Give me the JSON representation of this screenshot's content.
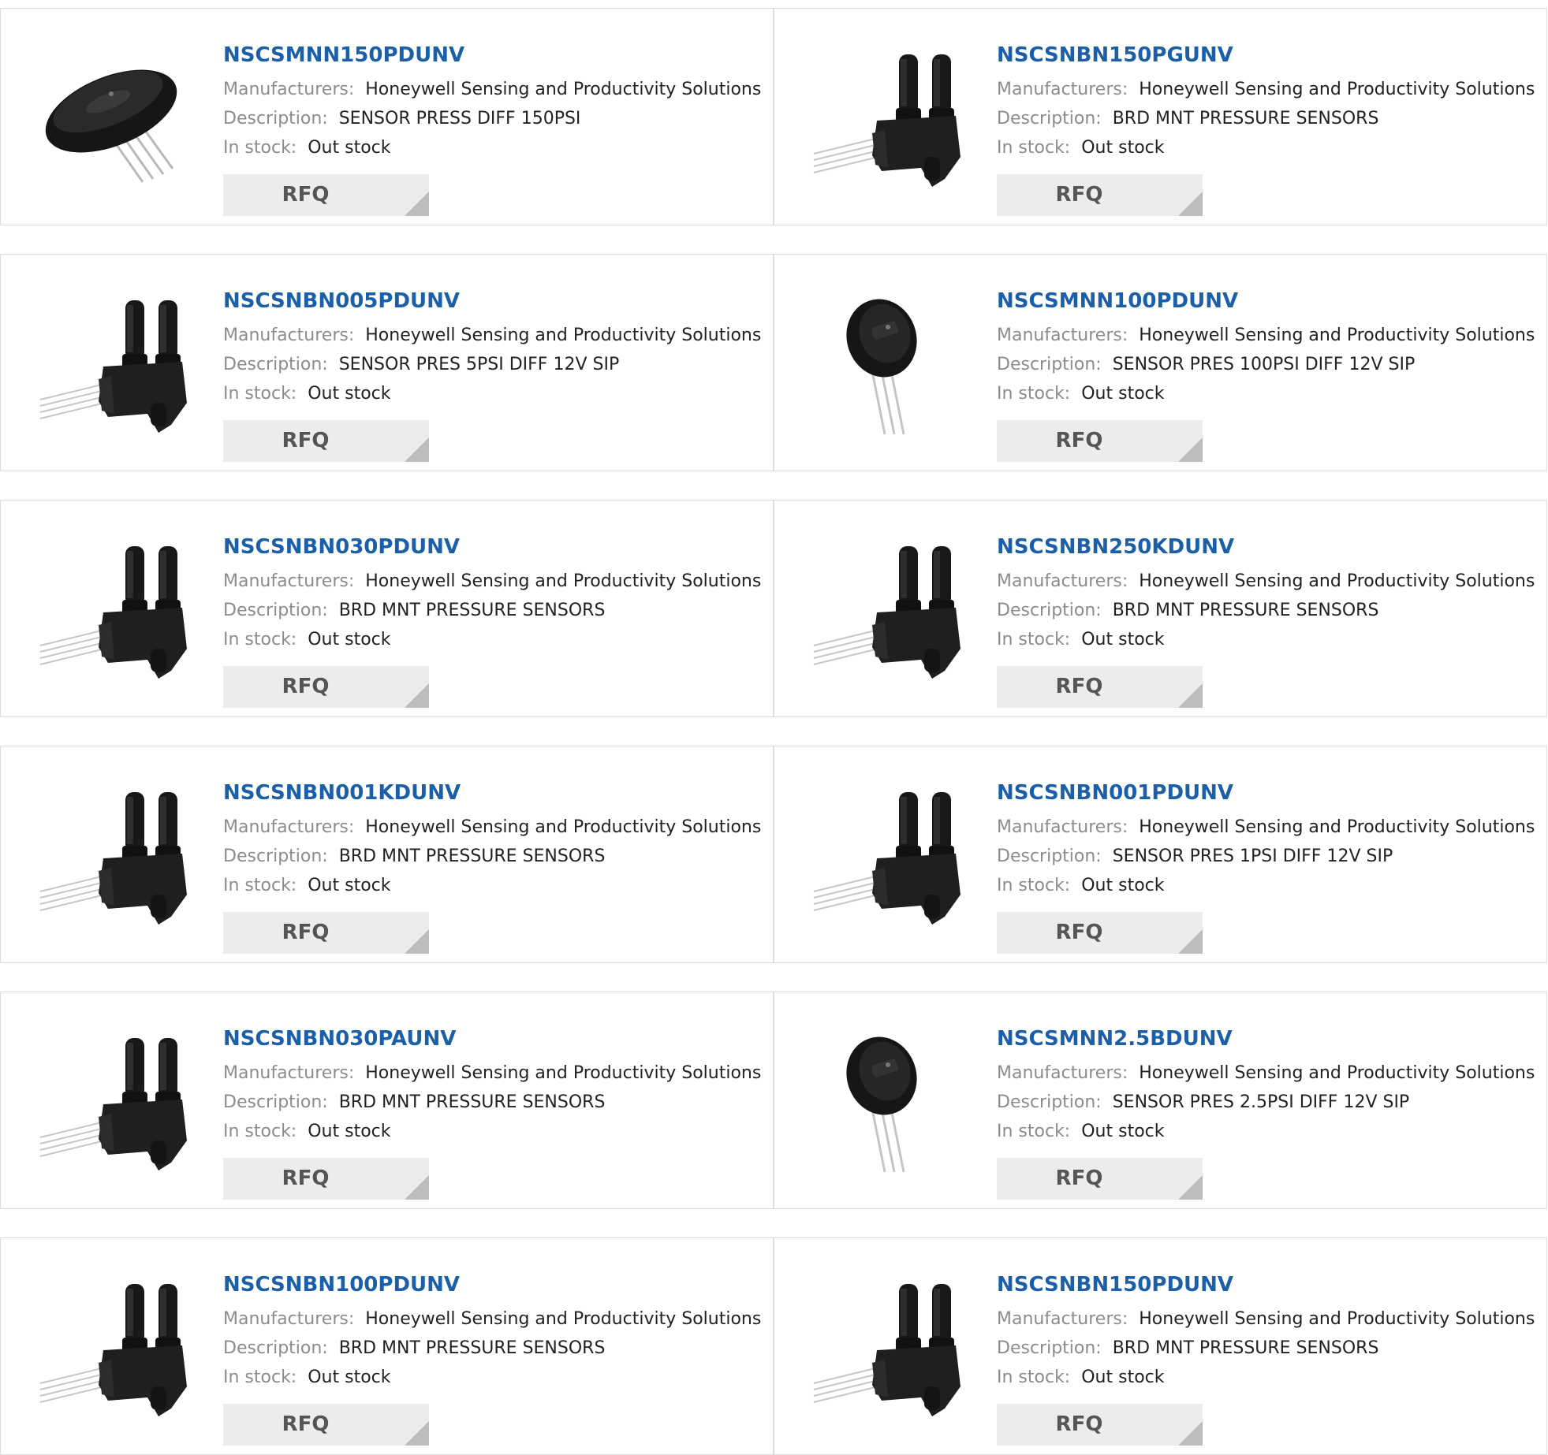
{
  "labels": {
    "manufacturers": "Manufacturers:",
    "description": "Description:",
    "in_stock": "In stock:",
    "rfq": "RFQ"
  },
  "products": [
    {
      "part": "NSCSMNN150PDUNV",
      "manufacturer": "Honeywell Sensing and Productivity Solutions",
      "description": "SENSOR PRESS DIFF 150PSI",
      "stock": "Out stock",
      "image": "round-sensor-horizontal"
    },
    {
      "part": "NSCSNBN150PGUNV",
      "manufacturer": "Honeywell Sensing and Productivity Solutions",
      "description": "BRD MNT PRESSURE SENSORS",
      "stock": "Out stock",
      "image": "dual-port-sensor"
    },
    {
      "part": "NSCSNBN005PDUNV",
      "manufacturer": "Honeywell Sensing and Productivity Solutions",
      "description": "SENSOR PRES 5PSI DIFF 12V SIP",
      "stock": "Out stock",
      "image": "dual-port-sensor"
    },
    {
      "part": "NSCSMNN100PDUNV",
      "manufacturer": "Honeywell Sensing and Productivity Solutions",
      "description": "SENSOR PRES 100PSI DIFF 12V SIP",
      "stock": "Out stock",
      "image": "round-sensor-vertical"
    },
    {
      "part": "NSCSNBN030PDUNV",
      "manufacturer": "Honeywell Sensing and Productivity Solutions",
      "description": "BRD MNT PRESSURE SENSORS",
      "stock": "Out stock",
      "image": "dual-port-sensor"
    },
    {
      "part": "NSCSNBN250KDUNV",
      "manufacturer": "Honeywell Sensing and Productivity Solutions",
      "description": "BRD MNT PRESSURE SENSORS",
      "stock": "Out stock",
      "image": "dual-port-sensor"
    },
    {
      "part": "NSCSNBN001KDUNV",
      "manufacturer": "Honeywell Sensing and Productivity Solutions",
      "description": "BRD MNT PRESSURE SENSORS",
      "stock": "Out stock",
      "image": "dual-port-sensor"
    },
    {
      "part": "NSCSNBN001PDUNV",
      "manufacturer": "Honeywell Sensing and Productivity Solutions",
      "description": "SENSOR PRES 1PSI DIFF 12V SIP",
      "stock": "Out stock",
      "image": "dual-port-sensor"
    },
    {
      "part": "NSCSNBN030PAUNV",
      "manufacturer": "Honeywell Sensing and Productivity Solutions",
      "description": "BRD MNT PRESSURE SENSORS",
      "stock": "Out stock",
      "image": "dual-port-sensor"
    },
    {
      "part": "NSCSMNN2.5BDUNV",
      "manufacturer": "Honeywell Sensing and Productivity Solutions",
      "description": "SENSOR PRES 2.5PSI DIFF 12V SIP",
      "stock": "Out stock",
      "image": "round-sensor-vertical"
    },
    {
      "part": "NSCSNBN100PDUNV",
      "manufacturer": "Honeywell Sensing and Productivity Solutions",
      "description": "BRD MNT PRESSURE SENSORS",
      "stock": "Out stock",
      "image": "dual-port-sensor"
    },
    {
      "part": "NSCSNBN150PDUNV",
      "manufacturer": "Honeywell Sensing and Productivity Solutions",
      "description": "BRD MNT PRESSURE SENSORS",
      "stock": "Out stock",
      "image": "dual-port-sensor"
    }
  ],
  "colors": {
    "link": "#1a5fa8",
    "label": "#8c8c8c",
    "value": "#222222",
    "button_bg": "#ececec",
    "button_text": "#555555",
    "border": "#dcdcdc"
  }
}
